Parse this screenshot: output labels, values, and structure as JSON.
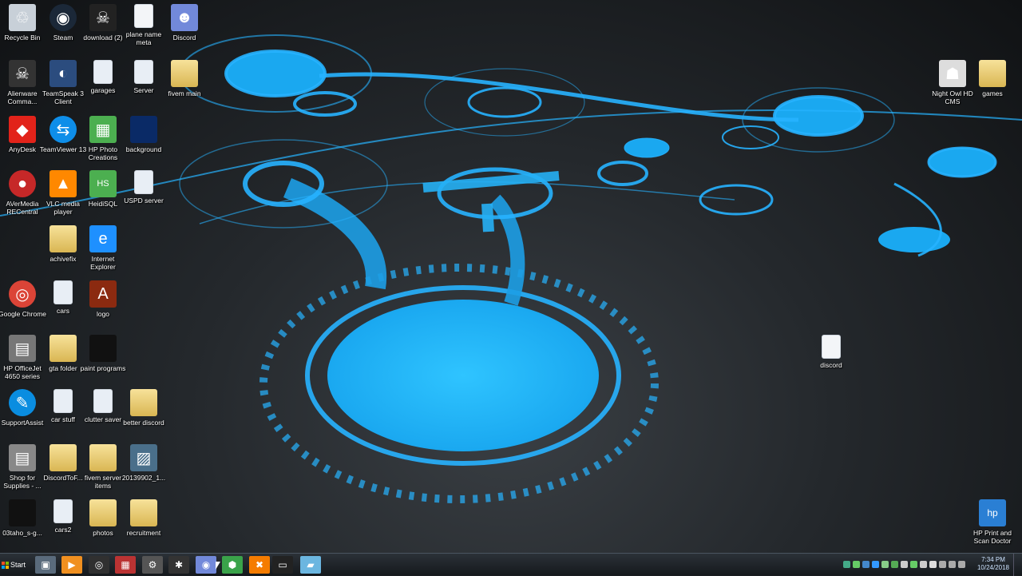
{
  "desktop_icons": [
    {
      "label": "Recycle Bin",
      "icon": "recycle-bin-icon",
      "color": "#c8d0d8"
    },
    {
      "label": "Steam",
      "icon": "steam-icon",
      "color": "#1b2838"
    },
    {
      "label": "download (2)",
      "icon": "skull-image-icon",
      "color": "#222"
    },
    {
      "label": "plane name meta",
      "icon": "document-icon",
      "color": "#f3f5f8"
    },
    {
      "label": "Discord",
      "icon": "discord-icon",
      "color": "#7289da"
    },
    {
      "label": "Alienware Comma...",
      "icon": "alienware-icon",
      "color": "#333"
    },
    {
      "label": "TeamSpeak 3 Client",
      "icon": "teamspeak-icon",
      "color": "#2b4c7e"
    },
    {
      "label": "garages",
      "icon": "notepad-icon",
      "color": "#e8eef5"
    },
    {
      "label": "Server",
      "icon": "notepad-icon",
      "color": "#e8eef5"
    },
    {
      "label": "fivem main",
      "icon": "folder-icon",
      "color": "#e8c86a"
    },
    {
      "label": "AnyDesk",
      "icon": "anydesk-icon",
      "color": "#e2231a"
    },
    {
      "label": "TeamViewer 13",
      "icon": "teamviewer-icon",
      "color": "#0e8ee9"
    },
    {
      "label": "HP Photo Creations",
      "icon": "hp-photo-icon",
      "color": "#4caf50"
    },
    {
      "label": "background",
      "icon": "image-icon",
      "color": "#0a2a66"
    },
    {
      "label": "AVerMedia RECentral",
      "icon": "avermedia-icon",
      "color": "#c62828"
    },
    {
      "label": "VLC media player",
      "icon": "vlc-icon",
      "color": "#ff8800"
    },
    {
      "label": "HeidiSQL",
      "icon": "heidisql-icon",
      "color": "#4caf50"
    },
    {
      "label": "USPD server",
      "icon": "settings-doc-icon",
      "color": "#e8eef5"
    },
    {
      "label": "achivefix",
      "icon": "folder-icon",
      "color": "#e8c86a"
    },
    {
      "label": "Internet Explorer",
      "icon": "internet-explorer-icon",
      "color": "#1e90ff"
    },
    {
      "label": "Google Chrome",
      "icon": "chrome-icon",
      "color": "#db4437"
    },
    {
      "label": "cars",
      "icon": "file-icon",
      "color": "#e8eef5"
    },
    {
      "label": "logo",
      "icon": "logo-image-icon",
      "color": "#8b2a10"
    },
    {
      "label": "HP OfficeJet 4650 series",
      "icon": "printer-icon",
      "color": "#777"
    },
    {
      "label": "gta folder",
      "icon": "folder-icon",
      "color": "#e8c86a"
    },
    {
      "label": "paint programs",
      "icon": "folder-dark-icon",
      "color": "#111"
    },
    {
      "label": "SupportAssist",
      "icon": "support-assist-icon",
      "color": "#0a8de0"
    },
    {
      "label": "car stuff",
      "icon": "file-icon",
      "color": "#e8eef5"
    },
    {
      "label": "clutter saver",
      "icon": "file-icon",
      "color": "#e8eef5"
    },
    {
      "label": "better discord",
      "icon": "folder-icon",
      "color": "#e8c86a"
    },
    {
      "label": "Shop for Supplies - ...",
      "icon": "printer-supplies-icon",
      "color": "#888"
    },
    {
      "label": "DiscordToF...",
      "icon": "folder-icon",
      "color": "#e8c86a"
    },
    {
      "label": "fivem server items",
      "icon": "folder-icon",
      "color": "#e8c86a"
    },
    {
      "label": "20139902_1...",
      "icon": "photo-icon",
      "color": "#4a6f8a"
    },
    {
      "label": "03taho_s-g...",
      "icon": "dark-image-icon",
      "color": "#111"
    },
    {
      "label": "cars2",
      "icon": "file-icon",
      "color": "#e8eef5"
    },
    {
      "label": "photos",
      "icon": "folder-icon",
      "color": "#e8c86a"
    },
    {
      "label": "recruitment",
      "icon": "folder-icon",
      "color": "#e8c86a"
    },
    {
      "label": "Night Owl HD CMS",
      "icon": "night-owl-icon",
      "color": "#ddd"
    },
    {
      "label": "games",
      "icon": "folder-icon",
      "color": "#e8c86a"
    },
    {
      "label": "discord",
      "icon": "document-icon",
      "color": "#f3f5f8"
    },
    {
      "label": "HP Print and Scan Doctor",
      "icon": "hp-doctor-icon",
      "color": "#2a7fd4"
    }
  ],
  "taskbar": {
    "start_label": "Start",
    "pinned": [
      {
        "name": "file-explorer-icon",
        "glyph": "▣",
        "color": "#5a6b7c"
      },
      {
        "name": "media-player-icon",
        "glyph": "▶",
        "color": "#f09020"
      },
      {
        "name": "obs-icon",
        "glyph": "◎",
        "color": "#303030"
      },
      {
        "name": "flag-app-icon",
        "glyph": "▦",
        "color": "#b33"
      },
      {
        "name": "gear-app-icon",
        "glyph": "⚙",
        "color": "#555"
      },
      {
        "name": "spider-app-icon",
        "glyph": "✱",
        "color": "#333"
      },
      {
        "name": "discord-taskbar-icon",
        "glyph": "◉",
        "color": "#7289da"
      },
      {
        "name": "hex-app-icon",
        "glyph": "⬢",
        "color": "#3aa34a"
      },
      {
        "name": "xampp-icon",
        "glyph": "✖",
        "color": "#f57c00"
      },
      {
        "name": "terminal-icon",
        "glyph": "▭",
        "color": "#222"
      },
      {
        "name": "notepad-taskbar-icon",
        "glyph": "▰",
        "color": "#6bb6e0"
      }
    ]
  },
  "tray": {
    "icon_colors": [
      "#4a8",
      "#6c6",
      "#48c",
      "#39f",
      "#8c8",
      "#5a5",
      "#ccc",
      "#6c6",
      "#ccc",
      "#ddd",
      "#aaa",
      "#aaa",
      "#aaa"
    ],
    "time": "7:34 PM",
    "date": "10/24/2018"
  }
}
